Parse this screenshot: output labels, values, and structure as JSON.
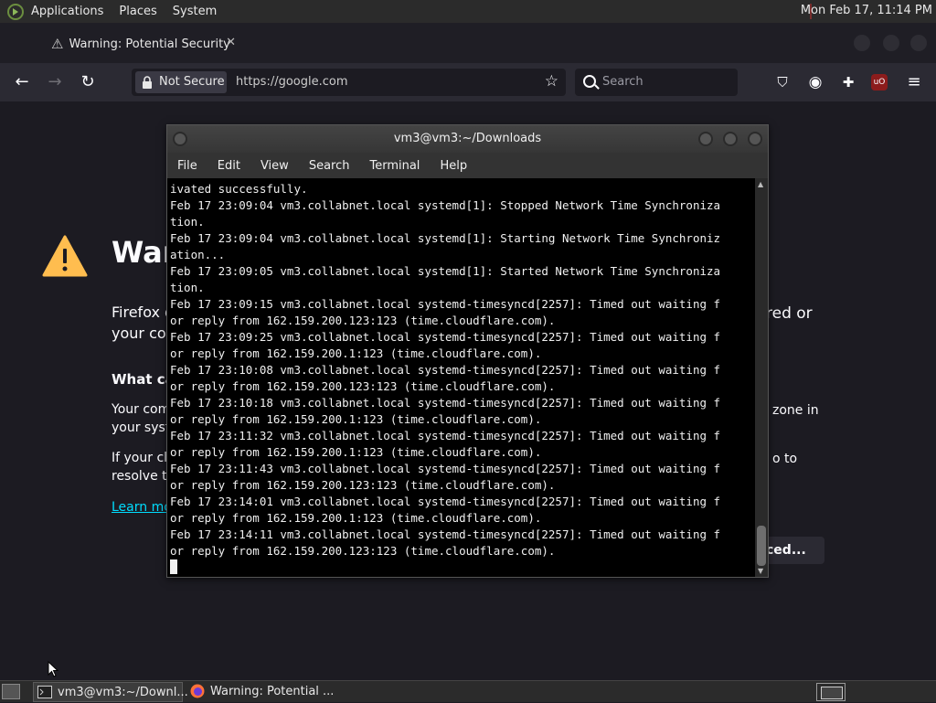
{
  "top_panel": {
    "menus": [
      "Applications",
      "Places",
      "System"
    ],
    "clock": "Mon Feb 17, 11:14 PM"
  },
  "browser": {
    "tab_title": "Warning: Potential Security",
    "not_secure_label": "Not Secure",
    "url": "https://google.com",
    "search_placeholder": "Search"
  },
  "error_page": {
    "title_visible": "War",
    "text_line1_left": "Firefox d",
    "text_line2_left": "your com",
    "text_line1_right": "red or",
    "heading_left": "What can",
    "para1_line1_left": "Your com",
    "para1_line2_left": "your syst",
    "para1_line1_right": "zone in",
    "para2_line1_left": "If your clo",
    "para2_line2_left": "resolve th",
    "para2_line1_right": "o to",
    "learn_more": "Learn mo",
    "advanced_button": "ced..."
  },
  "terminal": {
    "title": "vm3@vm3:~/Downloads",
    "menu": [
      "File",
      "Edit",
      "View",
      "Search",
      "Terminal",
      "Help"
    ],
    "lines": [
      "ivated successfully.",
      "Feb 17 23:09:04 vm3.collabnet.local systemd[1]: Stopped Network Time Synchroniza",
      "tion.",
      "Feb 17 23:09:04 vm3.collabnet.local systemd[1]: Starting Network Time Synchroniz",
      "ation...",
      "Feb 17 23:09:05 vm3.collabnet.local systemd[1]: Started Network Time Synchroniza",
      "tion.",
      "Feb 17 23:09:15 vm3.collabnet.local systemd-timesyncd[2257]: Timed out waiting f",
      "or reply from 162.159.200.123:123 (time.cloudflare.com).",
      "Feb 17 23:09:25 vm3.collabnet.local systemd-timesyncd[2257]: Timed out waiting f",
      "or reply from 162.159.200.1:123 (time.cloudflare.com).",
      "Feb 17 23:10:08 vm3.collabnet.local systemd-timesyncd[2257]: Timed out waiting f",
      "or reply from 162.159.200.123:123 (time.cloudflare.com).",
      "Feb 17 23:10:18 vm3.collabnet.local systemd-timesyncd[2257]: Timed out waiting f",
      "or reply from 162.159.200.1:123 (time.cloudflare.com).",
      "Feb 17 23:11:32 vm3.collabnet.local systemd-timesyncd[2257]: Timed out waiting f",
      "or reply from 162.159.200.1:123 (time.cloudflare.com).",
      "Feb 17 23:11:43 vm3.collabnet.local systemd-timesyncd[2257]: Timed out waiting f",
      "or reply from 162.159.200.123:123 (time.cloudflare.com).",
      "Feb 17 23:14:01 vm3.collabnet.local systemd-timesyncd[2257]: Timed out waiting f",
      "or reply from 162.159.200.1:123 (time.cloudflare.com).",
      "Feb 17 23:14:11 vm3.collabnet.local systemd-timesyncd[2257]: Timed out waiting f",
      "or reply from 162.159.200.123:123 (time.cloudflare.com)."
    ]
  },
  "taskbar": {
    "terminal_task": "vm3@vm3:~/Downl...",
    "firefox_task": "Warning: Potential ..."
  }
}
